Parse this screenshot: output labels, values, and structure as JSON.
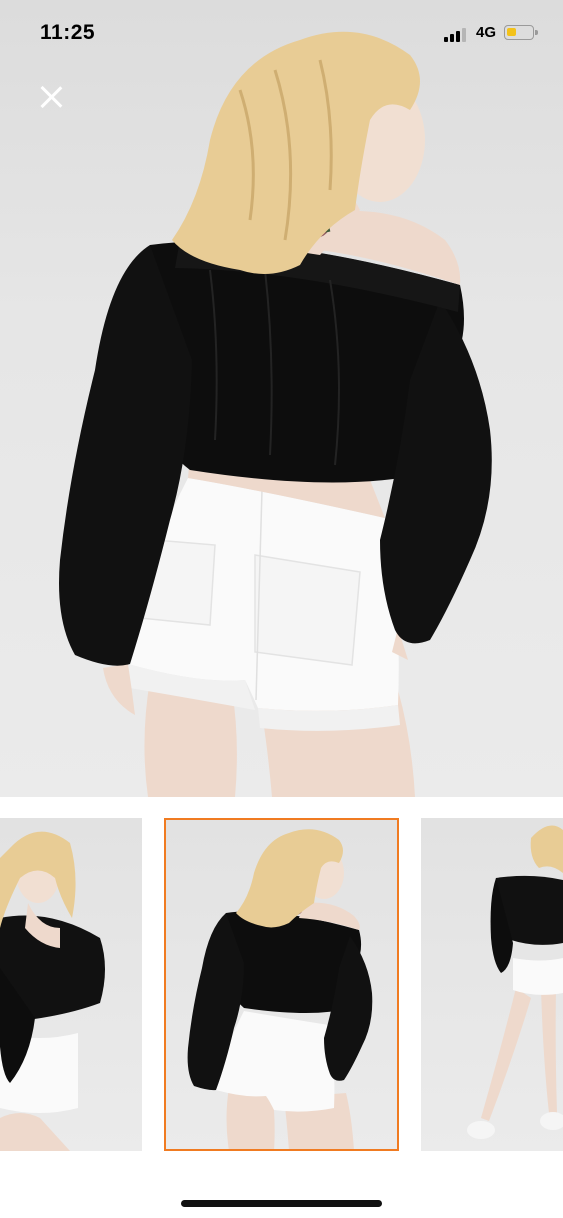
{
  "status_bar": {
    "time": "11:25",
    "network": "4G",
    "battery_color": "#f3c21a"
  },
  "viewer": {
    "close_icon": "close-icon",
    "selected_index": 1,
    "accent_color": "#f07b21"
  },
  "thumbnails": [
    {
      "view": "front",
      "selected": false
    },
    {
      "view": "back",
      "selected": true
    },
    {
      "view": "full-body",
      "selected": false
    }
  ]
}
